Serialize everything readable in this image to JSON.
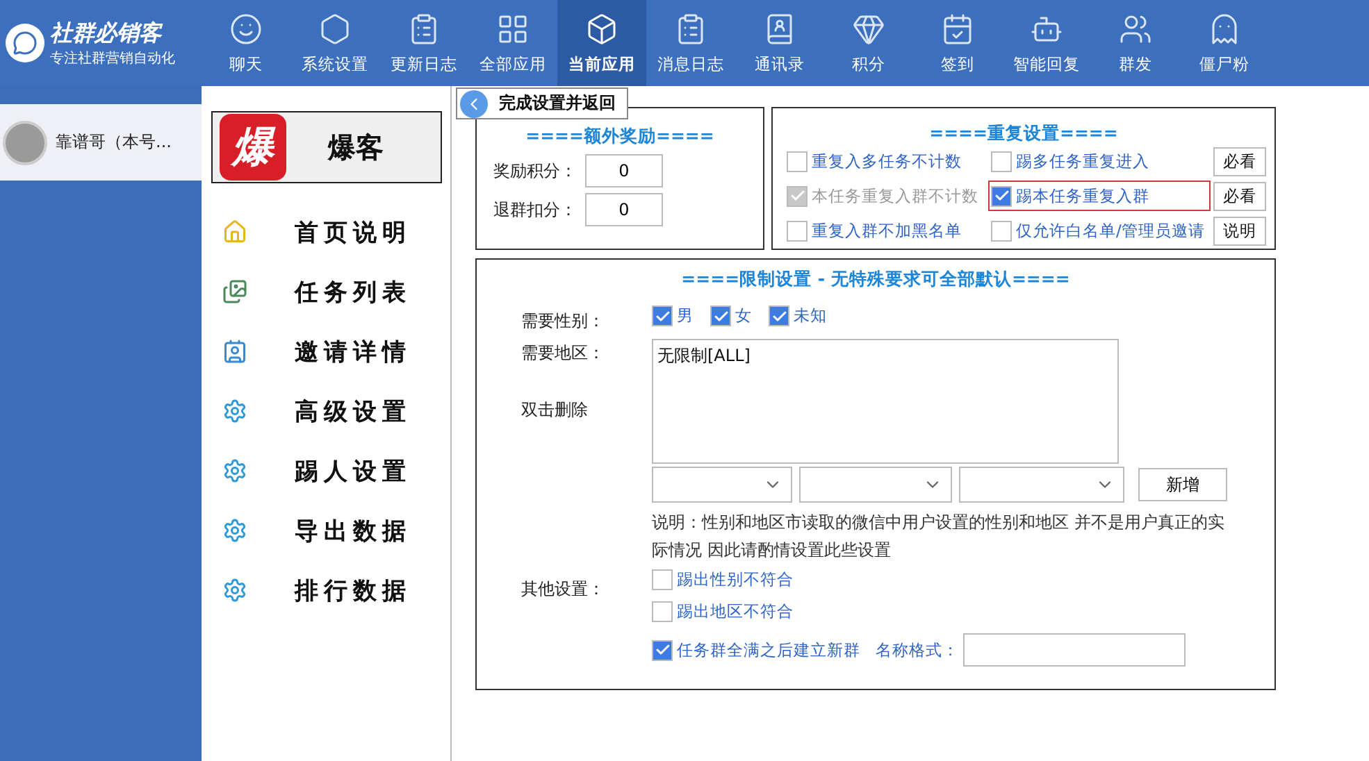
{
  "app": {
    "name": "社群必销客",
    "tagline": "专注社群营销自动化"
  },
  "nav": [
    {
      "label": "聊天",
      "selected": false
    },
    {
      "label": "系统设置",
      "selected": false
    },
    {
      "label": "更新日志",
      "selected": false
    },
    {
      "label": "全部应用",
      "selected": false
    },
    {
      "label": "当前应用",
      "selected": true
    },
    {
      "label": "消息日志",
      "selected": false
    },
    {
      "label": "通讯录",
      "selected": false
    },
    {
      "label": "积分",
      "selected": false
    },
    {
      "label": "签到",
      "selected": false
    },
    {
      "label": "智能回复",
      "selected": false
    },
    {
      "label": "群发",
      "selected": false
    },
    {
      "label": "僵尸粉",
      "selected": false
    }
  ],
  "account": {
    "name": "靠谱哥（本号..."
  },
  "plugin": {
    "title": "爆客",
    "logo": "爆"
  },
  "menu": [
    {
      "label": "首页说明",
      "kind": "home"
    },
    {
      "label": "任务列表",
      "kind": "list"
    },
    {
      "label": "邀请详情",
      "kind": "invite"
    },
    {
      "label": "高级设置",
      "kind": "gear"
    },
    {
      "label": "踢人设置",
      "kind": "gear"
    },
    {
      "label": "导出数据",
      "kind": "gear"
    },
    {
      "label": "排行数据",
      "kind": "gear"
    }
  ],
  "back_button": "完成设置并返回",
  "reward": {
    "title": "====额外奖励====",
    "fields": [
      {
        "label": "奖励积分：",
        "value": "0"
      },
      {
        "label": "退群扣分：",
        "value": "0"
      }
    ]
  },
  "repeat": {
    "title": "====重复设置====",
    "rows": [
      {
        "left": {
          "label": "重复入多任务不计数",
          "checked": false,
          "disabled": false,
          "highlighted": false
        },
        "right": {
          "label": "踢多任务重复进入",
          "checked": false,
          "disabled": false,
          "highlighted": false
        },
        "button": "必看"
      },
      {
        "left": {
          "label": "本任务重复入群不计数",
          "checked": true,
          "disabled": true,
          "highlighted": false
        },
        "right": {
          "label": "踢本任务重复入群",
          "checked": true,
          "disabled": false,
          "highlighted": true
        },
        "button": "必看"
      },
      {
        "left": {
          "label": "重复入群不加黑名单",
          "checked": false,
          "disabled": false,
          "highlighted": false
        },
        "right": {
          "label": "仅允许白名单/管理员邀请",
          "checked": false,
          "disabled": false,
          "highlighted": false
        },
        "button": "说明"
      }
    ]
  },
  "limits": {
    "title": "====限制设置 - 无特殊要求可全部默认====",
    "gender": {
      "label": "需要性别：",
      "options": [
        {
          "label": "男",
          "checked": true
        },
        {
          "label": "女",
          "checked": true
        },
        {
          "label": "未知",
          "checked": true
        }
      ]
    },
    "region": {
      "label": "需要地区：",
      "hint": "双击删除",
      "items": [
        "无限制[ALL]"
      ],
      "add_button": "新增"
    },
    "note": "说明：性别和地区市读取的微信中用户设置的性别和地区 并不是用户真正的实际情况 因此请酌情设置此些设置",
    "other": {
      "label": "其他设置：",
      "options": [
        {
          "label": "踢出性别不符合",
          "checked": false
        },
        {
          "label": "踢出地区不符合",
          "checked": false
        },
        {
          "label": "任务群全满之后建立新群",
          "checked": true
        }
      ],
      "name_format_label": "名称格式："
    }
  }
}
